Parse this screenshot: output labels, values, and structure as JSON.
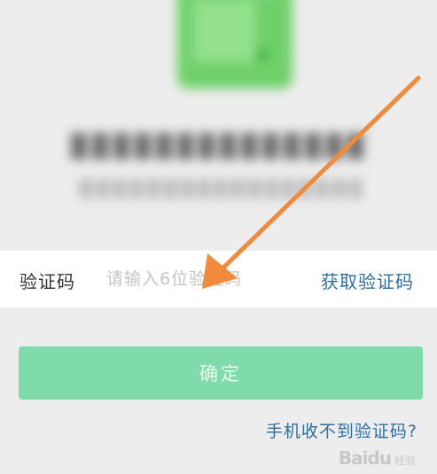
{
  "verification": {
    "label": "验证码",
    "input_placeholder": "请输入6位验证码",
    "input_value": "",
    "get_code_label": "获取验证码"
  },
  "actions": {
    "confirm_label": "确定",
    "no_code_label": "手机收不到验证码?"
  },
  "watermark": {
    "brand": "Baidu",
    "sub": "经验"
  },
  "colors": {
    "accent_link": "#2f6f9d",
    "confirm_button": "#7fdcaa",
    "arrow": "#f28a3c",
    "phone_green": "#6fd06a"
  }
}
